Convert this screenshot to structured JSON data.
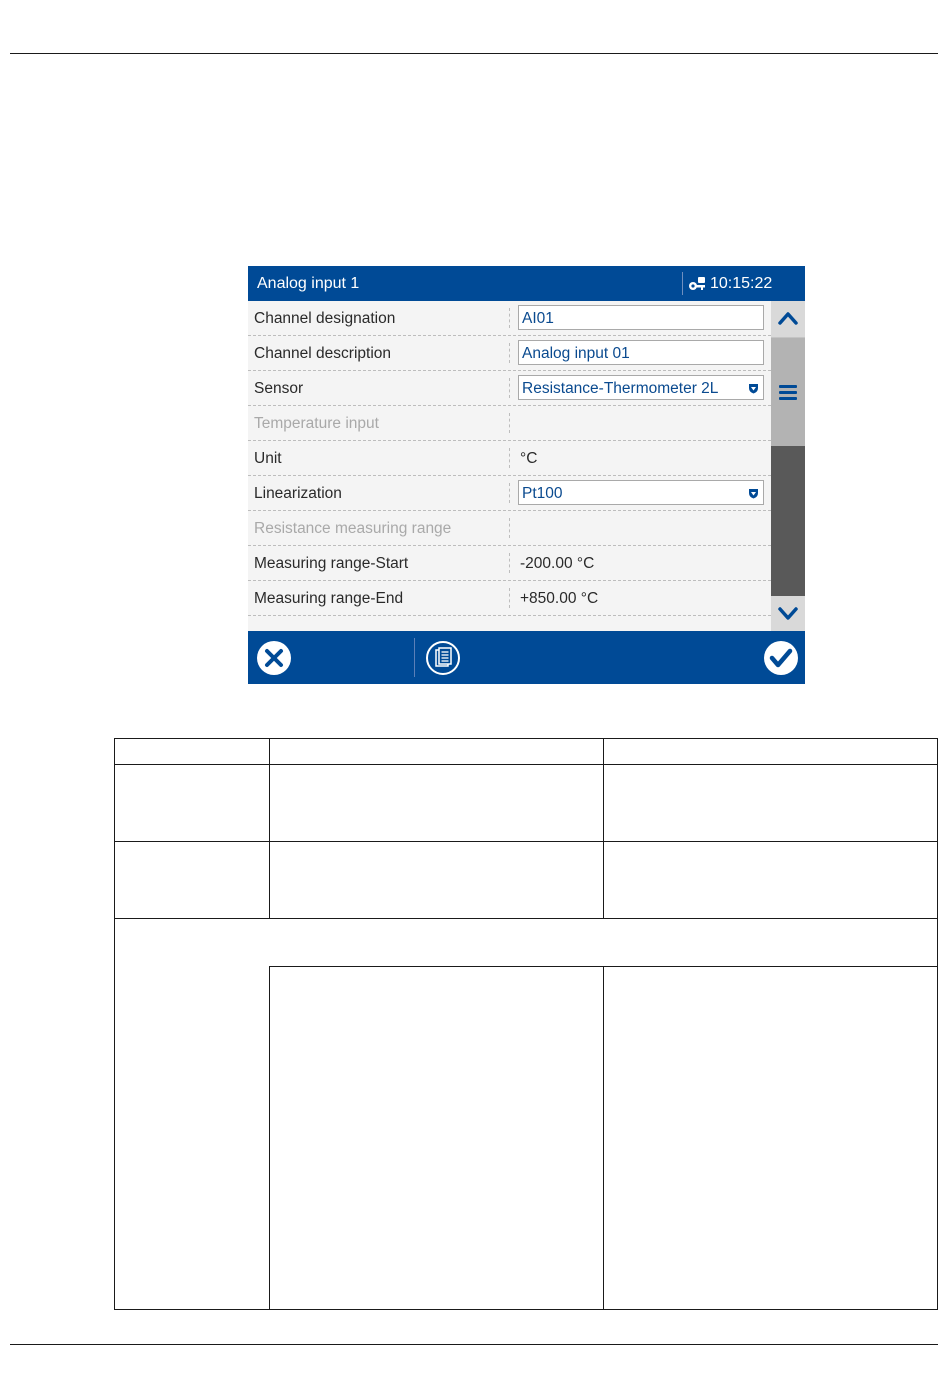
{
  "window": {
    "title": "Analog input 1",
    "time": "10:15:22",
    "lock_icon": "lock-key-icon"
  },
  "rows": [
    {
      "label": "Channel designation",
      "type": "field",
      "value": "AI01",
      "enabled": true
    },
    {
      "label": "Channel description",
      "type": "field",
      "value": "Analog input 01",
      "enabled": true
    },
    {
      "label": "Sensor",
      "type": "dropdown",
      "value": "Resistance-Thermometer 2L",
      "enabled": true
    },
    {
      "label": "Temperature input",
      "type": "none",
      "value": "",
      "enabled": false
    },
    {
      "label": "Unit",
      "type": "text",
      "value": "°C",
      "enabled": true
    },
    {
      "label": "Linearization",
      "type": "dropdown",
      "value": "Pt100",
      "enabled": true
    },
    {
      "label": "Resistance measuring range",
      "type": "none",
      "value": "",
      "enabled": false
    },
    {
      "label": "Measuring range-Start",
      "type": "text",
      "value": "-200.00 °C",
      "enabled": true
    },
    {
      "label": "Measuring range-End",
      "type": "text",
      "value": "+850.00 °C",
      "enabled": true
    }
  ],
  "scrollbar": {
    "up_icon": "chevron-up-icon",
    "menu_icon": "menu-icon",
    "down_icon": "chevron-down-icon"
  },
  "toolbar": {
    "cancel_icon": "close-circle-icon",
    "document_icon": "document-icon",
    "confirm_icon": "checkmark-circle-icon"
  },
  "colors": {
    "accent": "#004a96",
    "value_text": "#0a4a8f"
  }
}
